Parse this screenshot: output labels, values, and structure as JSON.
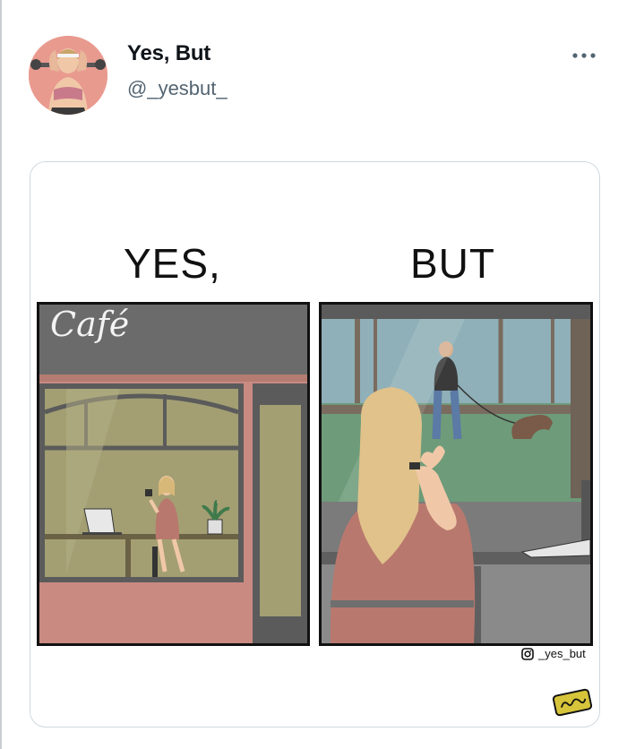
{
  "post": {
    "display_name": "Yes, But",
    "handle": "@_yesbut_",
    "more_icon": "more-horizontal-icon",
    "avatar_icon": "avatar-image"
  },
  "media": {
    "left_title": "YES,",
    "right_title": "BUT",
    "cafe_sign": "Café",
    "credit_handle": "_yes_but",
    "credit_icon": "instagram-icon"
  },
  "colors": {
    "handle_gray": "#536471",
    "card_border": "#cfd9de",
    "sign_gray": "#6b6b6b",
    "wall_pink": "#d9938a",
    "window_olive": "#a39f73",
    "park_green": "#6e9b7a"
  }
}
